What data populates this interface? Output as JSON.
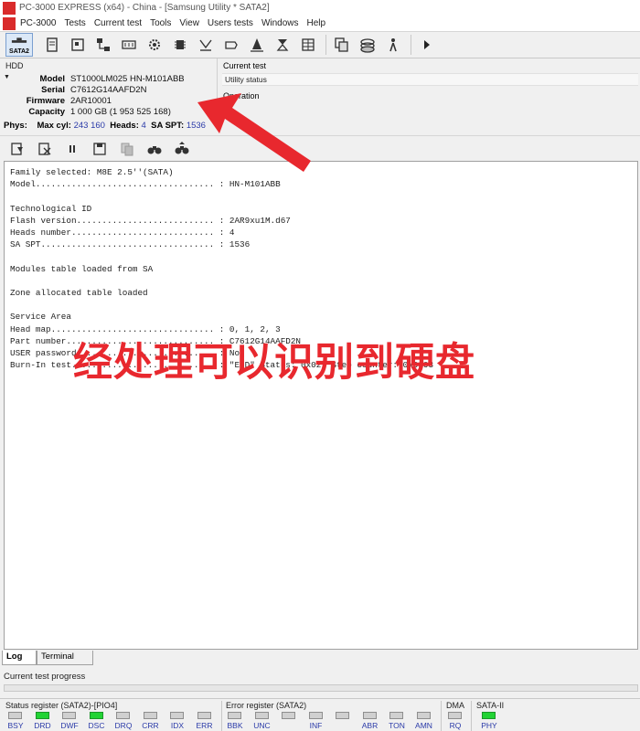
{
  "window": {
    "title": "PC-3000 EXPRESS (x64) - China - [Samsung Utility * SATA2]",
    "logo_text": "PC3K"
  },
  "menu": {
    "items": [
      "PC-3000",
      "Tests",
      "Current test",
      "Tools",
      "View",
      "Users tests",
      "Windows",
      "Help"
    ]
  },
  "toolbar": {
    "sata_label": "SATA2"
  },
  "hdd": {
    "caption": "HDD",
    "fields": [
      {
        "label": "Model",
        "value": "ST1000LM025 HN-M101ABB"
      },
      {
        "label": "Serial",
        "value": "C7612G14AAFD2N"
      },
      {
        "label": "Firmware",
        "value": "2AR10001"
      },
      {
        "label": "Capacity",
        "value": "1 000 GB (1 953 525 168)"
      }
    ]
  },
  "phys": {
    "label": "Phys:",
    "maxcyl_label": "Max cyl:",
    "maxcyl_value": "243 160",
    "heads_label": "Heads:",
    "heads_value": "4",
    "saspt_label": "SA SPT:",
    "saspt_value": "1536"
  },
  "current_test": {
    "caption": "Current test",
    "value": "Utility status",
    "operation_caption": "Operation"
  },
  "log": {
    "lines": [
      "Family selected: M8E 2.5''(SATA)",
      "Model................................... : HN-M101ABB",
      "",
      "Technological ID",
      "Flash version........................... : 2AR9xu1M.d67",
      "Heads number............................ : 4",
      "SA SPT.................................. : 1536",
      "",
      "Modules table loaded from SA",
      "",
      "Zone allocated table loaded",
      "",
      "Service Area",
      "Head map................................ : 0, 1, 2, 3",
      "Part number............................. : C7612G14AAFD2N",
      "USER password........................... : No",
      "Burn-In test............................ : \"END\" Status: 0x02, Step counter: 0x0003"
    ]
  },
  "overlay": {
    "caption": "经处理可以识别到硬盘",
    "arrow_color": "#e8282e"
  },
  "tabs": [
    "Log",
    "Terminal"
  ],
  "progress": {
    "label": "Current test progress",
    "fraction": 0
  },
  "status": {
    "status_register_caption": "Status register (SATA2)-[PIO4]",
    "error_register_caption": "Error register (SATA2)",
    "dma_caption": "DMA",
    "sata_caption": "SATA-II",
    "status_leds": [
      {
        "label": "BSY",
        "on": false
      },
      {
        "label": "DRD",
        "on": true
      },
      {
        "label": "DWF",
        "on": false
      },
      {
        "label": "DSC",
        "on": true
      },
      {
        "label": "DRQ",
        "on": false
      },
      {
        "label": "CRR",
        "on": false
      },
      {
        "label": "IDX",
        "on": false
      },
      {
        "label": "ERR",
        "on": false
      }
    ],
    "error_leds": [
      {
        "label": "BBK",
        "on": false
      },
      {
        "label": "UNC",
        "on": false
      },
      {
        "label": "",
        "on": false
      },
      {
        "label": "INF",
        "on": false
      },
      {
        "label": "",
        "on": false
      },
      {
        "label": "ABR",
        "on": false
      },
      {
        "label": "TON",
        "on": false
      },
      {
        "label": "AMN",
        "on": false
      }
    ],
    "dma_leds": [
      {
        "label": "RQ",
        "on": false
      }
    ],
    "sata_leds": [
      {
        "label": "PHY",
        "on": true
      }
    ],
    "led_on_color": "#22d334"
  }
}
